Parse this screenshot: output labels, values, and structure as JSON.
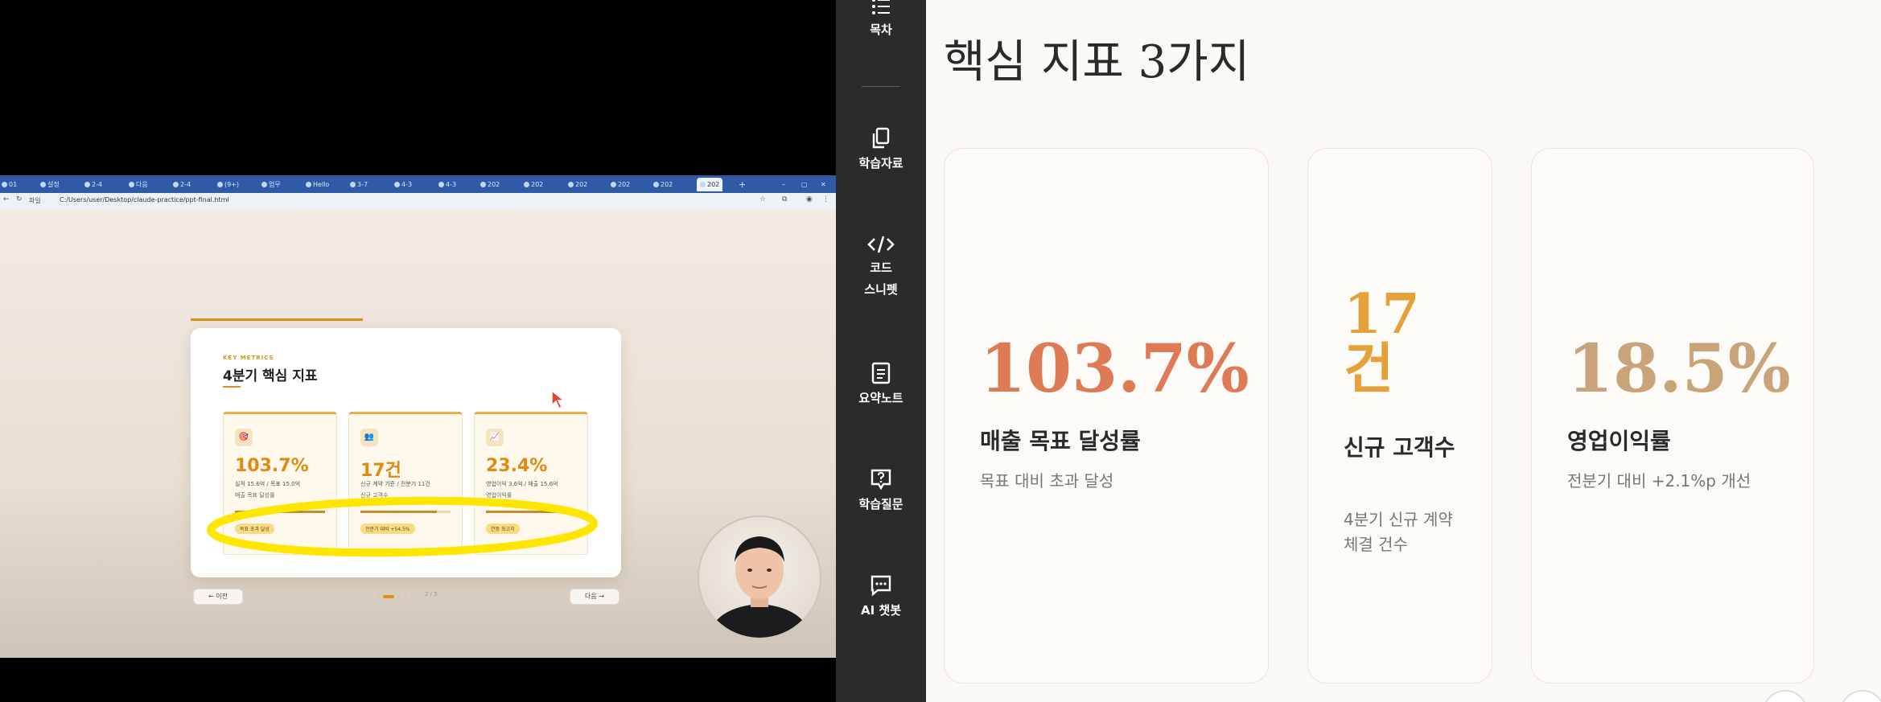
{
  "video": {
    "browser": {
      "tabs": [
        "01",
        "설정",
        "2-4",
        "다음",
        "2-4",
        "(9+)",
        "업무",
        "Hello",
        "3-7",
        "4-3",
        "4-3",
        "202",
        "202",
        "202",
        "202",
        "202",
        "202"
      ],
      "active_tab": "202",
      "address_prefix": "파일",
      "address": "C:/Users/user/Desktop/claude-practice/ppt-final.html"
    },
    "slide": {
      "eyebrow": "KEY METRICS",
      "title": "4분기 핵심 지표",
      "cards": [
        {
          "icon": "🎯",
          "icon_name": "target-icon",
          "value": "103.7%",
          "sub": "실적 15.6억 / 목표 15.0억",
          "label": "매출 목표 달성률",
          "progress": 1.0,
          "badge": "목표 초과 달성"
        },
        {
          "icon": "👥",
          "icon_name": "people-icon",
          "value": "17건",
          "sub": "신규 계약 기준 / 전분기 11건",
          "label": "신규 고객수",
          "progress": 0.85,
          "badge": "전분기 대비 +54.5%"
        },
        {
          "icon": "📈",
          "icon_name": "chart-up-icon",
          "value": "23.4%",
          "sub": "영업이익 3.6억 / 매출 15.6억",
          "label": "영업이익률",
          "progress": 0.95,
          "badge": "연중 최고치"
        }
      ],
      "prev_label": "← 이전",
      "next_label": "다음 →",
      "page_indicator": "2 / 5",
      "highlight_color": "#ffe600"
    }
  },
  "sidebar": {
    "items": [
      {
        "label": "목차",
        "icon": "list-icon"
      },
      {
        "label": "학습자료",
        "icon": "copy-icon"
      },
      {
        "label": "코드\n스니펫",
        "icon": "code-icon"
      },
      {
        "label": "요약노트",
        "icon": "note-icon"
      },
      {
        "label": "학습질문",
        "icon": "question-icon"
      },
      {
        "label": "AI 챗봇",
        "icon": "chat-icon"
      }
    ]
  },
  "content": {
    "title": "핵심 지표 3가지",
    "cards": [
      {
        "value": "103.7%",
        "label": "매출 목표 달성률",
        "desc": "목표 대비 초과 달성",
        "color": "#de7a56"
      },
      {
        "value": "17건",
        "label": "신규 고객수",
        "desc": "4분기 신규 계약 체결 건수",
        "color": "#e5a23a"
      },
      {
        "value": "18.5%",
        "label": "영업이익률",
        "desc": "전분기 대비 +2.1%p 개선",
        "color": "#c9a47a"
      }
    ]
  }
}
